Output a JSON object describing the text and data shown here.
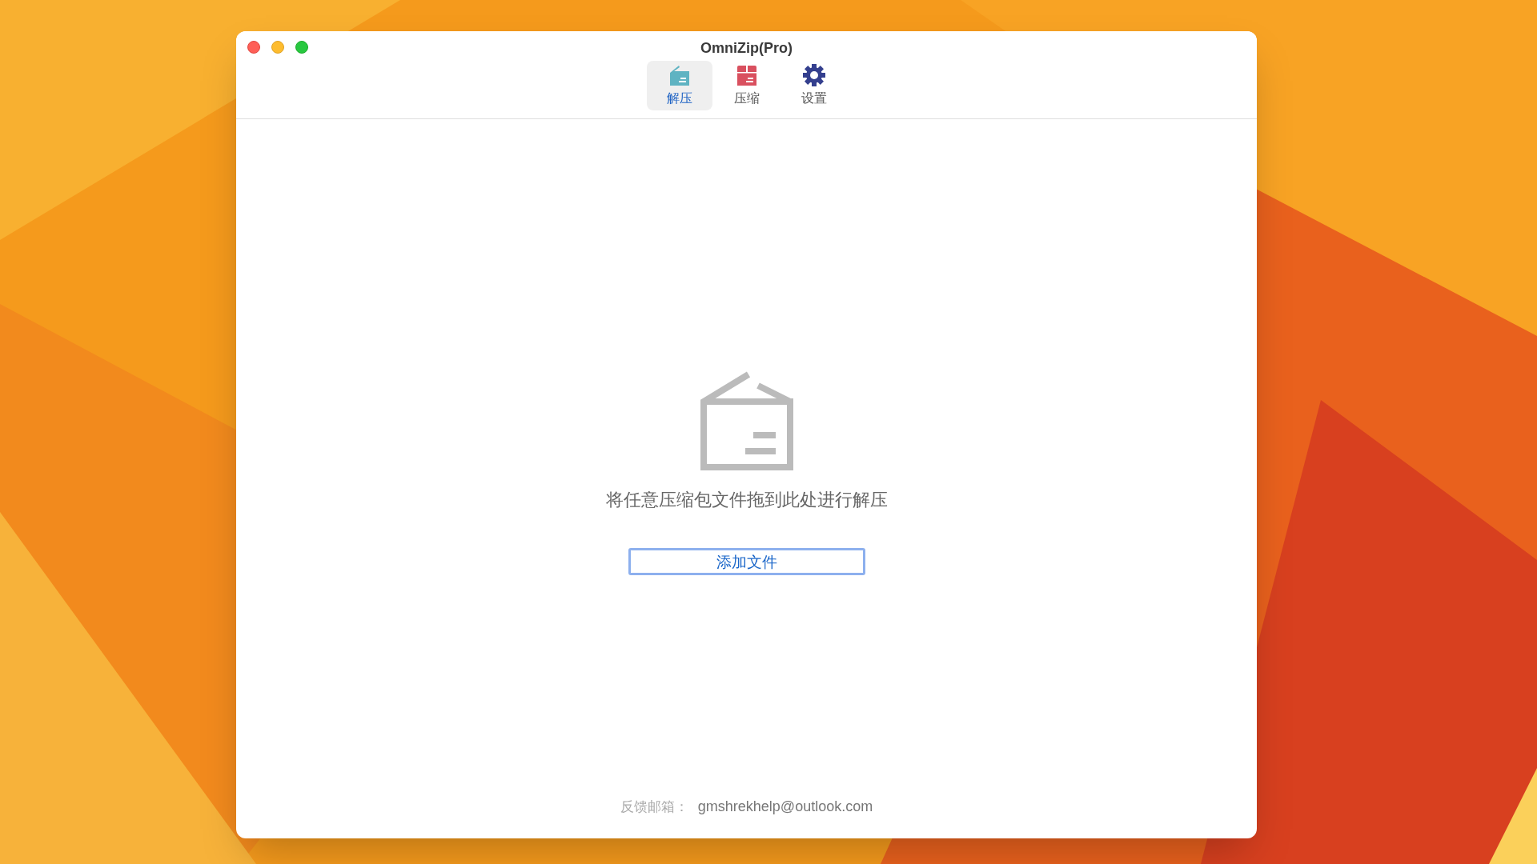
{
  "window": {
    "title": "OmniZip(Pro)"
  },
  "tabs": [
    {
      "label": "解压",
      "kind": "extract",
      "selected": true
    },
    {
      "label": "压缩",
      "kind": "compress",
      "selected": false
    },
    {
      "label": "设置",
      "kind": "settings",
      "selected": false
    }
  ],
  "drop_zone": {
    "message": "将任意压缩包文件拖到此处进行解压",
    "button": "添加文件"
  },
  "footer": {
    "label": "反馈邮箱：",
    "email": "gmshrekhelp@outlook.com"
  }
}
